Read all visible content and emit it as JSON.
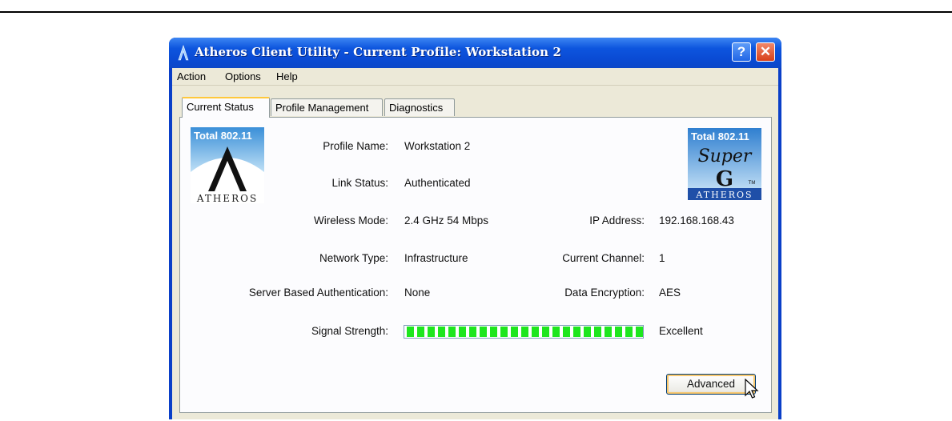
{
  "window": {
    "title": "Atheros Client Utility - Current Profile: Workstation 2",
    "help_button": "?",
    "close_button": "✕"
  },
  "menu": [
    "Action",
    "Options",
    "Help"
  ],
  "tabs": [
    "Current Status",
    "Profile Management",
    "Diagnostics"
  ],
  "active_tab": "Current Status",
  "logos": {
    "left": {
      "brand": "Total 802.11",
      "name": "ATHEROS"
    },
    "right": {
      "brand": "Total 802.11",
      "line2": "Super",
      "line3": "G",
      "tm": "TM",
      "name": "ATHEROS"
    }
  },
  "status": {
    "profile_name_label": "Profile Name:",
    "profile_name": "Workstation 2",
    "link_status_label": "Link Status:",
    "link_status": "Authenticated",
    "wireless_mode_label": "Wireless Mode:",
    "wireless_mode": "2.4 GHz 54 Mbps",
    "ip_address_label": "IP Address:",
    "ip_address": "192.168.168.43",
    "network_type_label": "Network Type:",
    "network_type": "Infrastructure",
    "current_channel_label": "Current Channel:",
    "current_channel": "1",
    "server_auth_label": "Server Based Authentication:",
    "server_auth": "None",
    "data_encryption_label": "Data Encryption:",
    "data_encryption": "AES",
    "signal_strength_label": "Signal Strength:",
    "signal_strength_text": "Excellent",
    "signal_strength_level": 1.0
  },
  "buttons": {
    "advanced": "Advanced"
  },
  "colors": {
    "titlebar": "#0a4bd4",
    "signal": "#1ee61e",
    "face": "#ece9d8"
  }
}
